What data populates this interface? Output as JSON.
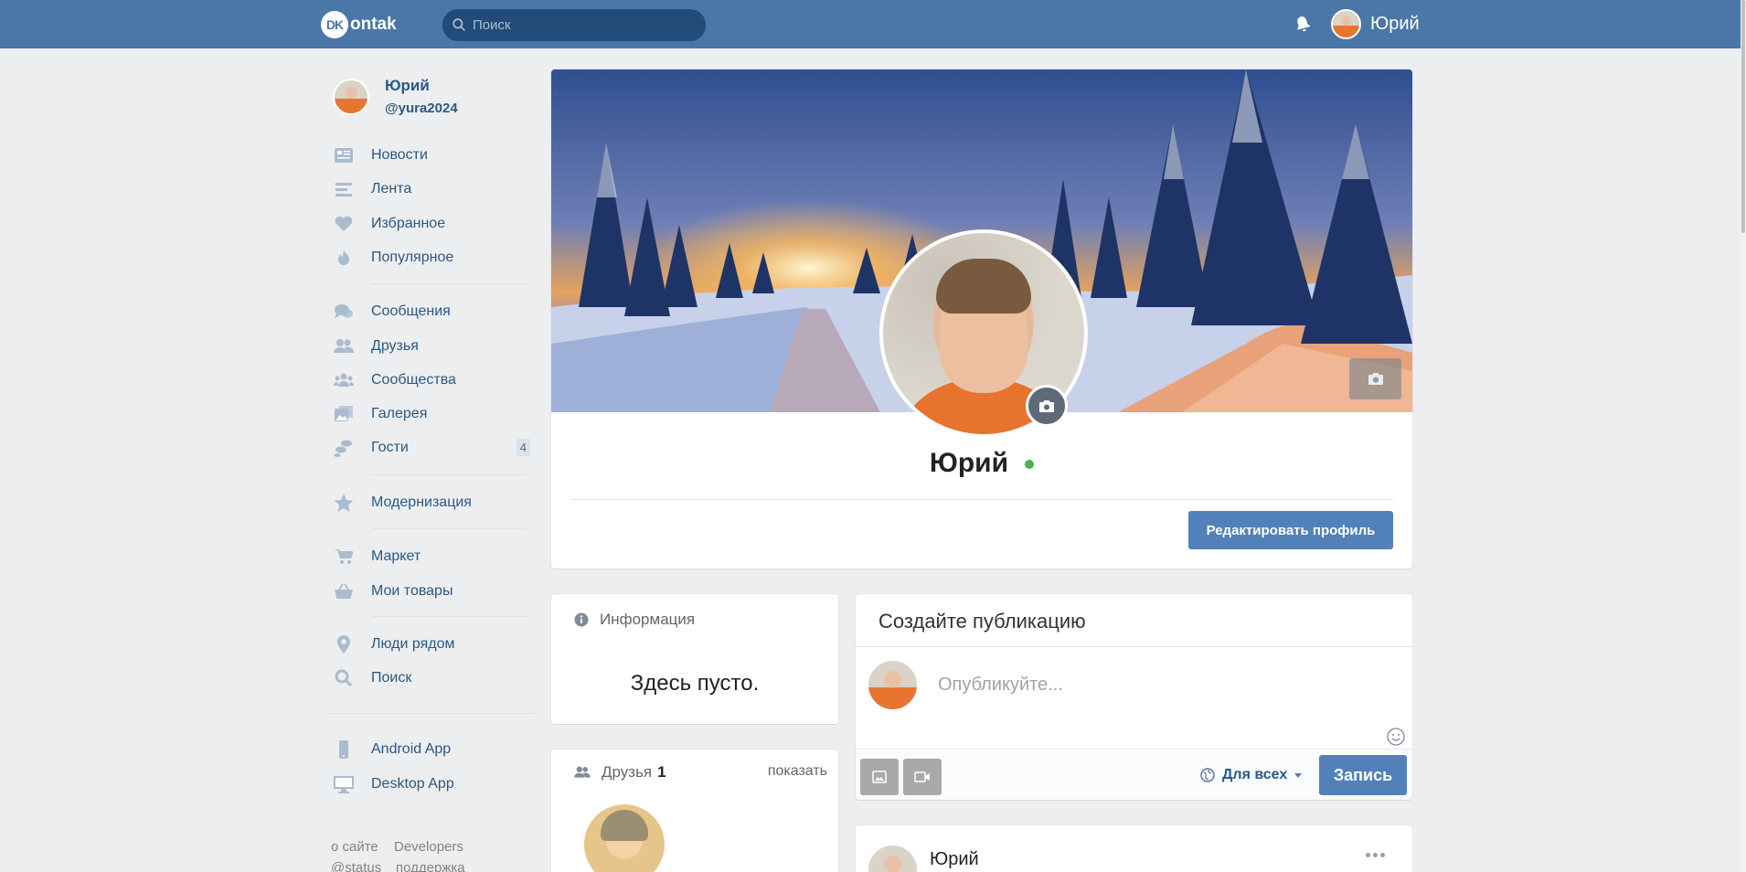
{
  "header": {
    "logo_badge": "DK",
    "logo_text": "ontak",
    "search_placeholder": "Поиск",
    "user_name": "Юрий"
  },
  "sidebar": {
    "user_name": "Юрий",
    "user_handle": "@yura2024",
    "items": [
      {
        "label": "Новости",
        "icon": "newspaper-icon"
      },
      {
        "label": "Лента",
        "icon": "feed-icon"
      },
      {
        "label": "Избранное",
        "icon": "heart-icon"
      },
      {
        "label": "Популярное",
        "icon": "fire-icon"
      },
      {
        "label": "Сообщения",
        "icon": "messages-icon"
      },
      {
        "label": "Друзья",
        "icon": "friends-icon"
      },
      {
        "label": "Сообщества",
        "icon": "communities-icon"
      },
      {
        "label": "Галерея",
        "icon": "gallery-icon"
      },
      {
        "label": "Гости",
        "icon": "guests-icon",
        "badge": "4"
      },
      {
        "label": "Модернизация",
        "icon": "star-icon"
      },
      {
        "label": "Маркет",
        "icon": "cart-icon"
      },
      {
        "label": "Мои товары",
        "icon": "basket-icon"
      },
      {
        "label": "Люди рядом",
        "icon": "location-pin-icon"
      },
      {
        "label": "Поиск",
        "icon": "search-icon"
      },
      {
        "label": "Android App",
        "icon": "phone-icon"
      },
      {
        "label": "Desktop App",
        "icon": "monitor-icon"
      }
    ],
    "footer": {
      "about": "о сайте",
      "developers": "Developers",
      "status": "@status",
      "support": "поддержка"
    }
  },
  "profile": {
    "name": "Юрий",
    "online": true,
    "edit_button": "Редактировать профиль"
  },
  "info": {
    "title": "Информация",
    "empty_text": "Здесь пусто."
  },
  "friends": {
    "title": "Друзья",
    "count": "1",
    "show_link": "показать"
  },
  "composer": {
    "title": "Создайте публикацию",
    "placeholder": "Опубликуйте...",
    "privacy": "Для всех",
    "submit": "Запись"
  },
  "post": {
    "author": "Юрий"
  },
  "colors": {
    "header_bg": "#4a76a8",
    "accent_button": "#5181b8",
    "online_dot": "#4bb34b",
    "link": "#2a5885"
  }
}
